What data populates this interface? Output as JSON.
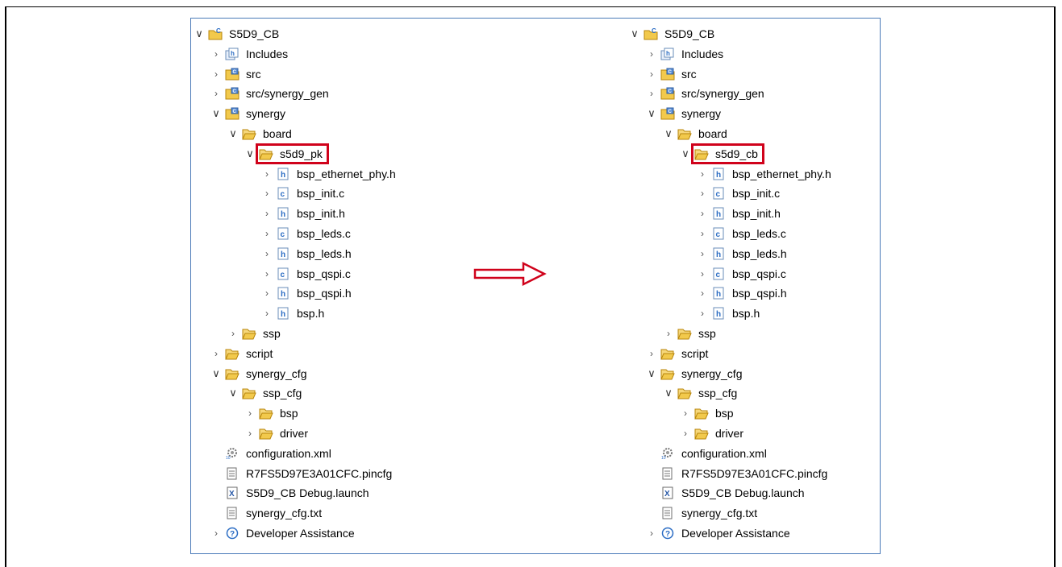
{
  "left_tree": [
    {
      "label": "S5D9_CB",
      "icon": "project-icon",
      "level": 0,
      "chevron": "open"
    },
    {
      "label": "Includes",
      "icon": "includes-icon",
      "level": 1,
      "chevron": "closed"
    },
    {
      "label": "src",
      "icon": "source-folder-icon",
      "level": 1,
      "chevron": "closed"
    },
    {
      "label": "src/synergy_gen",
      "icon": "source-folder-icon",
      "level": 1,
      "chevron": "closed"
    },
    {
      "label": "synergy",
      "icon": "source-folder-icon",
      "level": 1,
      "chevron": "open"
    },
    {
      "label": "board",
      "icon": "open-folder-icon",
      "level": 2,
      "chevron": "open"
    },
    {
      "label": "s5d9_pk",
      "icon": "open-folder-icon",
      "level": 3,
      "chevron": "open",
      "highlight": true
    },
    {
      "label": "bsp_ethernet_phy.h",
      "icon": "header-file-icon",
      "level": 4,
      "chevron": "closed"
    },
    {
      "label": "bsp_init.c",
      "icon": "c-file-icon",
      "level": 4,
      "chevron": "closed"
    },
    {
      "label": "bsp_init.h",
      "icon": "header-file-icon",
      "level": 4,
      "chevron": "closed"
    },
    {
      "label": "bsp_leds.c",
      "icon": "c-file-icon",
      "level": 4,
      "chevron": "closed"
    },
    {
      "label": "bsp_leds.h",
      "icon": "header-file-icon",
      "level": 4,
      "chevron": "closed"
    },
    {
      "label": "bsp_qspi.c",
      "icon": "c-file-icon",
      "level": 4,
      "chevron": "closed"
    },
    {
      "label": "bsp_qspi.h",
      "icon": "header-file-icon",
      "level": 4,
      "chevron": "closed"
    },
    {
      "label": "bsp.h",
      "icon": "header-file-icon",
      "level": 4,
      "chevron": "closed"
    },
    {
      "label": "ssp",
      "icon": "open-folder-icon",
      "level": 2,
      "chevron": "closed"
    },
    {
      "label": "script",
      "icon": "open-folder-icon",
      "level": 1,
      "chevron": "closed"
    },
    {
      "label": "synergy_cfg",
      "icon": "open-folder-icon",
      "level": 1,
      "chevron": "open"
    },
    {
      "label": "ssp_cfg",
      "icon": "open-folder-icon",
      "level": 2,
      "chevron": "open"
    },
    {
      "label": "bsp",
      "icon": "open-folder-icon",
      "level": 3,
      "chevron": "closed"
    },
    {
      "label": "driver",
      "icon": "open-folder-icon",
      "level": 3,
      "chevron": "closed"
    },
    {
      "label": "configuration.xml",
      "icon": "config-gear-icon",
      "level": 1,
      "chevron": "none"
    },
    {
      "label": "R7FS5D97E3A01CFC.pincfg",
      "icon": "text-file-icon",
      "level": 1,
      "chevron": "none"
    },
    {
      "label": "S5D9_CB Debug.launch",
      "icon": "launch-file-icon",
      "level": 1,
      "chevron": "none"
    },
    {
      "label": "synergy_cfg.txt",
      "icon": "text-file-icon",
      "level": 1,
      "chevron": "none"
    },
    {
      "label": "Developer Assistance",
      "icon": "help-icon",
      "level": 1,
      "chevron": "closed"
    }
  ],
  "right_tree": [
    {
      "label": "S5D9_CB",
      "icon": "project-icon",
      "level": 0,
      "chevron": "open"
    },
    {
      "label": "Includes",
      "icon": "includes-icon",
      "level": 1,
      "chevron": "closed"
    },
    {
      "label": "src",
      "icon": "source-folder-icon",
      "level": 1,
      "chevron": "closed"
    },
    {
      "label": "src/synergy_gen",
      "icon": "source-folder-icon",
      "level": 1,
      "chevron": "closed"
    },
    {
      "label": "synergy",
      "icon": "source-folder-icon",
      "level": 1,
      "chevron": "open"
    },
    {
      "label": "board",
      "icon": "open-folder-icon",
      "level": 2,
      "chevron": "open"
    },
    {
      "label": "s5d9_cb",
      "icon": "open-folder-icon",
      "level": 3,
      "chevron": "open",
      "highlight": true
    },
    {
      "label": "bsp_ethernet_phy.h",
      "icon": "header-file-icon",
      "level": 4,
      "chevron": "closed"
    },
    {
      "label": "bsp_init.c",
      "icon": "c-file-icon",
      "level": 4,
      "chevron": "closed"
    },
    {
      "label": "bsp_init.h",
      "icon": "header-file-icon",
      "level": 4,
      "chevron": "closed"
    },
    {
      "label": "bsp_leds.c",
      "icon": "c-file-icon",
      "level": 4,
      "chevron": "closed"
    },
    {
      "label": "bsp_leds.h",
      "icon": "header-file-icon",
      "level": 4,
      "chevron": "closed"
    },
    {
      "label": "bsp_qspi.c",
      "icon": "c-file-icon",
      "level": 4,
      "chevron": "closed"
    },
    {
      "label": "bsp_qspi.h",
      "icon": "header-file-icon",
      "level": 4,
      "chevron": "closed"
    },
    {
      "label": "bsp.h",
      "icon": "header-file-icon",
      "level": 4,
      "chevron": "closed"
    },
    {
      "label": "ssp",
      "icon": "open-folder-icon",
      "level": 2,
      "chevron": "closed"
    },
    {
      "label": "script",
      "icon": "open-folder-icon",
      "level": 1,
      "chevron": "closed"
    },
    {
      "label": "synergy_cfg",
      "icon": "open-folder-icon",
      "level": 1,
      "chevron": "open"
    },
    {
      "label": "ssp_cfg",
      "icon": "open-folder-icon",
      "level": 2,
      "chevron": "open"
    },
    {
      "label": "bsp",
      "icon": "open-folder-icon",
      "level": 3,
      "chevron": "closed"
    },
    {
      "label": "driver",
      "icon": "open-folder-icon",
      "level": 3,
      "chevron": "closed"
    },
    {
      "label": "configuration.xml",
      "icon": "config-gear-icon",
      "level": 1,
      "chevron": "none"
    },
    {
      "label": "R7FS5D97E3A01CFC.pincfg",
      "icon": "text-file-icon",
      "level": 1,
      "chevron": "none"
    },
    {
      "label": "S5D9_CB Debug.launch",
      "icon": "launch-file-icon",
      "level": 1,
      "chevron": "none"
    },
    {
      "label": "synergy_cfg.txt",
      "icon": "text-file-icon",
      "level": 1,
      "chevron": "none"
    },
    {
      "label": "Developer Assistance",
      "icon": "help-icon",
      "level": 1,
      "chevron": "closed"
    }
  ],
  "colors": {
    "highlight": "#d0021b",
    "panel_border": "#4a7ab8",
    "arrow": "#d0021b",
    "folder": "#f2c94c"
  }
}
